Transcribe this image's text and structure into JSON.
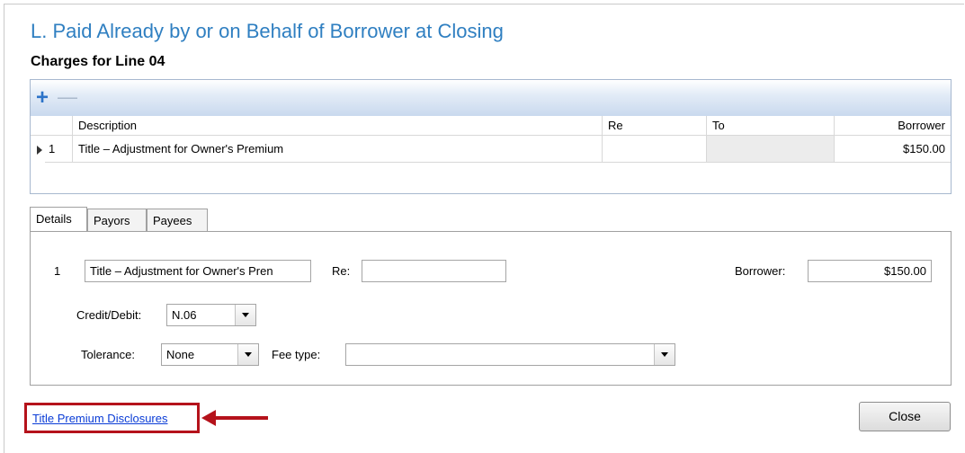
{
  "header": {
    "title": "L. Paid Already by or on Behalf of Borrower at Closing",
    "subtitle": "Charges for Line 04"
  },
  "grid": {
    "toolbar": {
      "add_icon": "plus-icon",
      "remove_icon": "minus-icon"
    },
    "columns": [
      "Description",
      "Re",
      "To",
      "Borrower"
    ],
    "rows": [
      {
        "index": "1",
        "description": "Title – Adjustment for Owner's Premium",
        "re": "",
        "to": "",
        "borrower": "$150.00"
      }
    ]
  },
  "tabs": [
    {
      "label": "Details",
      "active": true
    },
    {
      "label": "Payors",
      "active": false
    },
    {
      "label": "Payees",
      "active": false
    }
  ],
  "details": {
    "line_number": "1",
    "description_value": "Title – Adjustment for Owner's Pren",
    "re_label": "Re:",
    "re_value": "",
    "borrower_label": "Borrower:",
    "borrower_value": "$150.00",
    "credit_debit_label": "Credit/Debit:",
    "credit_debit_value": "N.06",
    "tolerance_label": "Tolerance:",
    "tolerance_value": "None",
    "fee_type_label": "Fee type:",
    "fee_type_value": ""
  },
  "footer": {
    "link_text": "Title Premium Disclosures",
    "close_label": "Close"
  },
  "colors": {
    "title": "#2f7fc1",
    "highlight": "#b5121b",
    "link": "#0a3cd6"
  }
}
